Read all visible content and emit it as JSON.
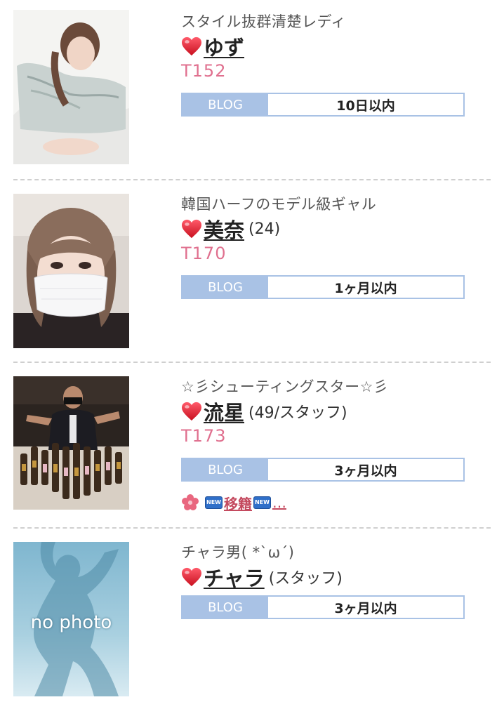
{
  "entries": [
    {
      "catch_phrase": "スタイル抜群清楚レディ",
      "name": "ゆず",
      "age_info": "",
      "height": "T152",
      "blog_label": "BLOG",
      "blog_time": "10日以内",
      "photo": "photo-1"
    },
    {
      "catch_phrase": "韓国ハーフのモデル級ギャル",
      "name": "美奈",
      "age_info": "(24)",
      "height": "T170",
      "blog_label": "BLOG",
      "blog_time": "1ヶ月以内",
      "photo": "photo-2"
    },
    {
      "catch_phrase": "☆彡シューティングスター☆彡",
      "name": "流星",
      "age_info": "(49/スタッフ)",
      "height": "T173",
      "blog_label": "BLOG",
      "blog_time": "3ヶ月以内",
      "photo": "photo-3",
      "news": {
        "badge1": "NEW",
        "text": "移籍",
        "badge2": "NEW",
        "ellipsis": "…"
      }
    },
    {
      "catch_phrase": "チャラ男( *`ω´)",
      "name": "チャラ",
      "age_info": "(スタッフ)",
      "height": "",
      "blog_label": "BLOG",
      "blog_time": "3ヶ月以内",
      "photo": "no-photo",
      "no_photo_text": "no photo"
    }
  ],
  "colors": {
    "heart": "#e0192b",
    "height_text": "#e0708f",
    "blog_accent": "#a9c2e5",
    "news_text": "#c44a5f",
    "divider": "#cfcfcf"
  }
}
